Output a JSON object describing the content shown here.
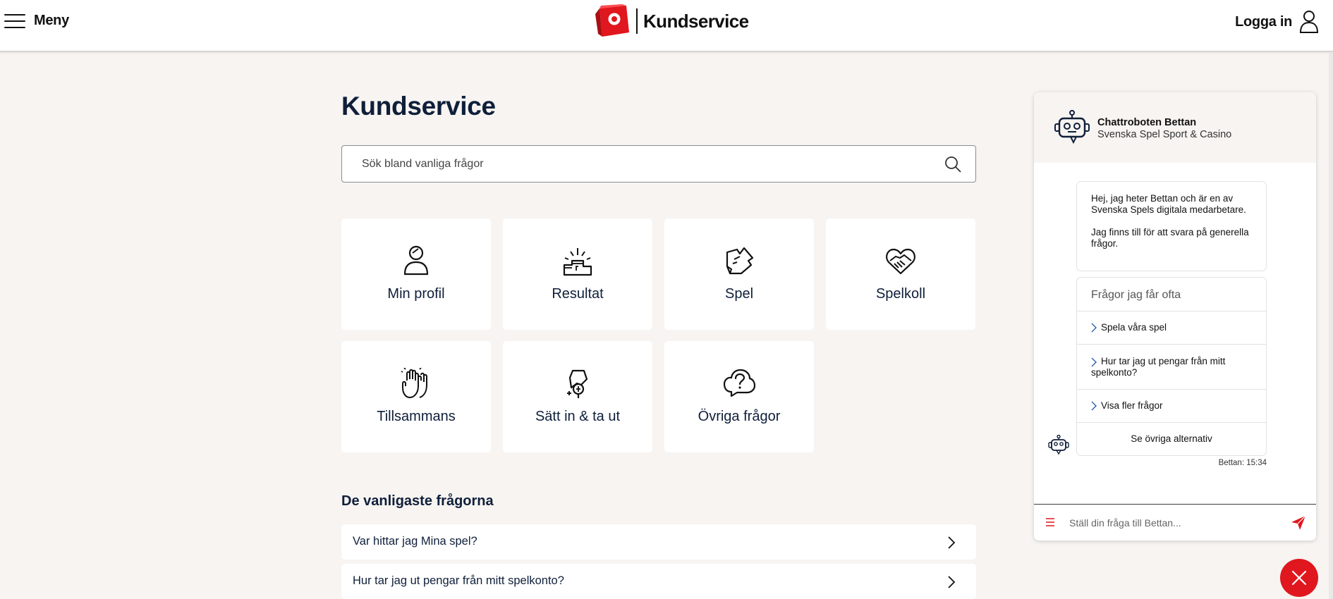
{
  "header": {
    "menu_label": "Meny",
    "brand_title": "Kundservice",
    "login_label": "Logga in"
  },
  "main": {
    "title": "Kundservice",
    "search_placeholder": "Sök bland vanliga frågor",
    "tiles": [
      {
        "label": "Min profil",
        "icon": "person-icon"
      },
      {
        "label": "Resultat",
        "icon": "podium-icon"
      },
      {
        "label": "Spel",
        "icon": "ticket-icon"
      },
      {
        "label": "Spelkoll",
        "icon": "heart-handshake-icon"
      },
      {
        "label": "Tillsammans",
        "icon": "high-five-icon"
      },
      {
        "label": "Sätt in & ta ut",
        "icon": "money-icon"
      },
      {
        "label": "Övriga frågor",
        "icon": "question-cloud-icon"
      }
    ],
    "faq_heading": "De vanligaste frågorna",
    "faq": [
      "Var hittar jag Mina spel?",
      "Hur tar jag ut pengar från mitt spelkonto?"
    ]
  },
  "chat": {
    "bot_name": "Chattroboten Bettan",
    "bot_subtitle": "Svenska Spel Sport & Casino",
    "greeting_1": "Hej, jag heter Bettan och är en av Svenska Spels digitala medarbetare.",
    "greeting_2": "Jag finns till för att svara på generella frågor.",
    "faq_heading": "Frågor jag får ofta",
    "faq_items": [
      "Spela våra spel",
      "Hur tar jag ut pengar från mitt spelkonto?",
      "Visa fler frågor"
    ],
    "more_options": "Se övriga alternativ",
    "timestamp": "Bettan: 15:34",
    "input_placeholder": "Ställ din fråga till Bettan..."
  },
  "colors": {
    "brand_red": "#e0171e",
    "navy": "#0f1f3a",
    "page_bg": "#f7f4f1"
  }
}
